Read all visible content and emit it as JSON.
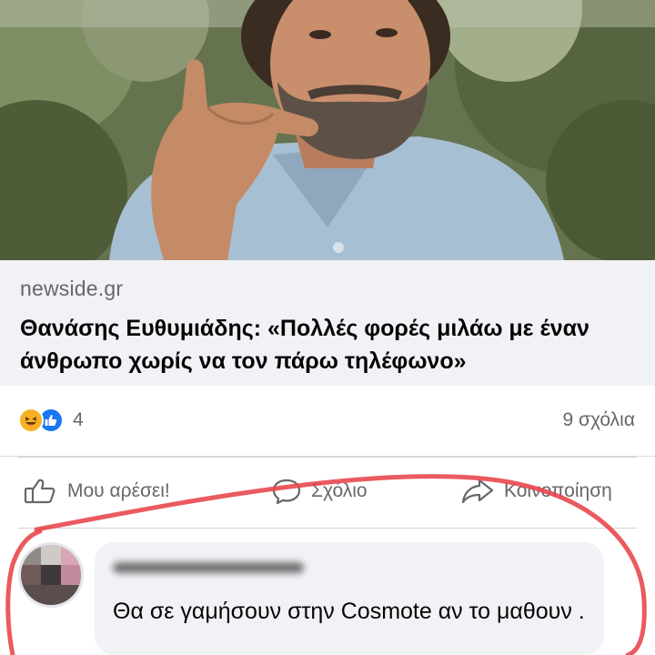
{
  "post": {
    "photo": {
      "description_icon": "person-photo"
    },
    "link": {
      "domain": "newside.gr",
      "title": "Θανάσης Ευθυμιάδης: «Πολλές φορές μιλάω με έναν άνθρωπο χωρίς να τον πάρω τηλέφωνο»"
    },
    "reactions": {
      "icons": [
        "haha-icon",
        "like-icon"
      ],
      "count": "4",
      "comments": "9 σχόλια"
    },
    "actions": {
      "like": "Μου αρέσει!",
      "comment": "Σχόλιο",
      "share": "Κοινοποίηση"
    }
  },
  "comment": {
    "text": "Θα σε γαμήσουν στην Cosmote αν το μαθουν ."
  },
  "colors": {
    "facebook_blue": "#1877f2",
    "haha_yellow": "#f7b125",
    "annotation_red": "#e8484e",
    "muted_text": "#65676b"
  }
}
